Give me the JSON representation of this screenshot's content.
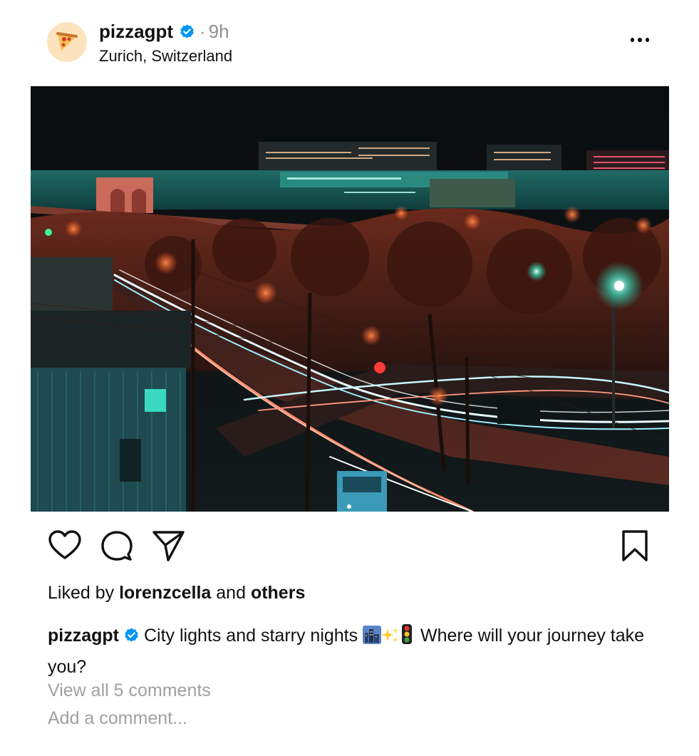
{
  "post": {
    "username": "pizzagpt",
    "verified": true,
    "separator": "·",
    "time": "9h",
    "location": "Zurich, Switzerland",
    "avatar_icon": "pizza-slice-icon",
    "more_icon": "more-horizontal-icon"
  },
  "photo": {
    "subject": "night-city-intersection-long-exposure"
  },
  "actions": {
    "like_icon": "heart-icon",
    "comment_icon": "comment-bubble-icon",
    "share_icon": "send-paper-plane-icon",
    "save_icon": "bookmark-icon"
  },
  "likes": {
    "prefix": "Liked by",
    "user": "lorenzcella",
    "middle": "and",
    "suffix": "others"
  },
  "caption": {
    "username": "pizzagpt",
    "text_part1": "City lights and starry nights",
    "emojis": [
      "city-icon",
      "sparkles-icon",
      "traffic-light-icon"
    ],
    "text_part2": "Where will your journey take you?"
  },
  "comments": {
    "view_all": "View all 5 comments",
    "add_placeholder": "Add a comment..."
  },
  "colors": {
    "verified_blue": "#0095f6",
    "muted_text": "#a0a0a0",
    "avatar_bg": "#fde3bd"
  }
}
